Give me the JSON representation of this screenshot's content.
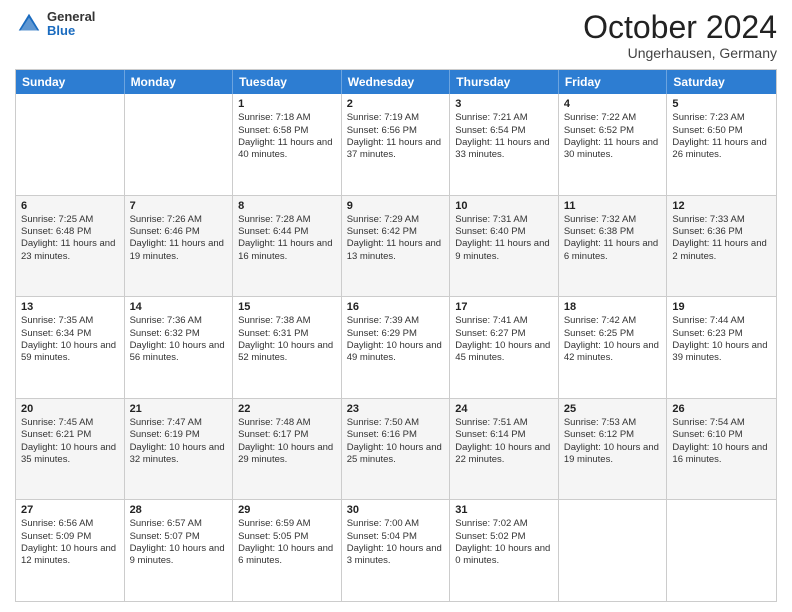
{
  "header": {
    "logo_general": "General",
    "logo_blue": "Blue",
    "month_title": "October 2024",
    "location": "Ungerhausen, Germany"
  },
  "days_of_week": [
    "Sunday",
    "Monday",
    "Tuesday",
    "Wednesday",
    "Thursday",
    "Friday",
    "Saturday"
  ],
  "rows": [
    [
      {
        "day": "",
        "sunrise": "",
        "sunset": "",
        "daylight": "",
        "shaded": false
      },
      {
        "day": "",
        "sunrise": "",
        "sunset": "",
        "daylight": "",
        "shaded": false
      },
      {
        "day": "1",
        "sunrise": "Sunrise: 7:18 AM",
        "sunset": "Sunset: 6:58 PM",
        "daylight": "Daylight: 11 hours and 40 minutes.",
        "shaded": false
      },
      {
        "day": "2",
        "sunrise": "Sunrise: 7:19 AM",
        "sunset": "Sunset: 6:56 PM",
        "daylight": "Daylight: 11 hours and 37 minutes.",
        "shaded": false
      },
      {
        "day": "3",
        "sunrise": "Sunrise: 7:21 AM",
        "sunset": "Sunset: 6:54 PM",
        "daylight": "Daylight: 11 hours and 33 minutes.",
        "shaded": false
      },
      {
        "day": "4",
        "sunrise": "Sunrise: 7:22 AM",
        "sunset": "Sunset: 6:52 PM",
        "daylight": "Daylight: 11 hours and 30 minutes.",
        "shaded": false
      },
      {
        "day": "5",
        "sunrise": "Sunrise: 7:23 AM",
        "sunset": "Sunset: 6:50 PM",
        "daylight": "Daylight: 11 hours and 26 minutes.",
        "shaded": false
      }
    ],
    [
      {
        "day": "6",
        "sunrise": "Sunrise: 7:25 AM",
        "sunset": "Sunset: 6:48 PM",
        "daylight": "Daylight: 11 hours and 23 minutes.",
        "shaded": true
      },
      {
        "day": "7",
        "sunrise": "Sunrise: 7:26 AM",
        "sunset": "Sunset: 6:46 PM",
        "daylight": "Daylight: 11 hours and 19 minutes.",
        "shaded": true
      },
      {
        "day": "8",
        "sunrise": "Sunrise: 7:28 AM",
        "sunset": "Sunset: 6:44 PM",
        "daylight": "Daylight: 11 hours and 16 minutes.",
        "shaded": true
      },
      {
        "day": "9",
        "sunrise": "Sunrise: 7:29 AM",
        "sunset": "Sunset: 6:42 PM",
        "daylight": "Daylight: 11 hours and 13 minutes.",
        "shaded": true
      },
      {
        "day": "10",
        "sunrise": "Sunrise: 7:31 AM",
        "sunset": "Sunset: 6:40 PM",
        "daylight": "Daylight: 11 hours and 9 minutes.",
        "shaded": true
      },
      {
        "day": "11",
        "sunrise": "Sunrise: 7:32 AM",
        "sunset": "Sunset: 6:38 PM",
        "daylight": "Daylight: 11 hours and 6 minutes.",
        "shaded": true
      },
      {
        "day": "12",
        "sunrise": "Sunrise: 7:33 AM",
        "sunset": "Sunset: 6:36 PM",
        "daylight": "Daylight: 11 hours and 2 minutes.",
        "shaded": true
      }
    ],
    [
      {
        "day": "13",
        "sunrise": "Sunrise: 7:35 AM",
        "sunset": "Sunset: 6:34 PM",
        "daylight": "Daylight: 10 hours and 59 minutes.",
        "shaded": false
      },
      {
        "day": "14",
        "sunrise": "Sunrise: 7:36 AM",
        "sunset": "Sunset: 6:32 PM",
        "daylight": "Daylight: 10 hours and 56 minutes.",
        "shaded": false
      },
      {
        "day": "15",
        "sunrise": "Sunrise: 7:38 AM",
        "sunset": "Sunset: 6:31 PM",
        "daylight": "Daylight: 10 hours and 52 minutes.",
        "shaded": false
      },
      {
        "day": "16",
        "sunrise": "Sunrise: 7:39 AM",
        "sunset": "Sunset: 6:29 PM",
        "daylight": "Daylight: 10 hours and 49 minutes.",
        "shaded": false
      },
      {
        "day": "17",
        "sunrise": "Sunrise: 7:41 AM",
        "sunset": "Sunset: 6:27 PM",
        "daylight": "Daylight: 10 hours and 45 minutes.",
        "shaded": false
      },
      {
        "day": "18",
        "sunrise": "Sunrise: 7:42 AM",
        "sunset": "Sunset: 6:25 PM",
        "daylight": "Daylight: 10 hours and 42 minutes.",
        "shaded": false
      },
      {
        "day": "19",
        "sunrise": "Sunrise: 7:44 AM",
        "sunset": "Sunset: 6:23 PM",
        "daylight": "Daylight: 10 hours and 39 minutes.",
        "shaded": false
      }
    ],
    [
      {
        "day": "20",
        "sunrise": "Sunrise: 7:45 AM",
        "sunset": "Sunset: 6:21 PM",
        "daylight": "Daylight: 10 hours and 35 minutes.",
        "shaded": true
      },
      {
        "day": "21",
        "sunrise": "Sunrise: 7:47 AM",
        "sunset": "Sunset: 6:19 PM",
        "daylight": "Daylight: 10 hours and 32 minutes.",
        "shaded": true
      },
      {
        "day": "22",
        "sunrise": "Sunrise: 7:48 AM",
        "sunset": "Sunset: 6:17 PM",
        "daylight": "Daylight: 10 hours and 29 minutes.",
        "shaded": true
      },
      {
        "day": "23",
        "sunrise": "Sunrise: 7:50 AM",
        "sunset": "Sunset: 6:16 PM",
        "daylight": "Daylight: 10 hours and 25 minutes.",
        "shaded": true
      },
      {
        "day": "24",
        "sunrise": "Sunrise: 7:51 AM",
        "sunset": "Sunset: 6:14 PM",
        "daylight": "Daylight: 10 hours and 22 minutes.",
        "shaded": true
      },
      {
        "day": "25",
        "sunrise": "Sunrise: 7:53 AM",
        "sunset": "Sunset: 6:12 PM",
        "daylight": "Daylight: 10 hours and 19 minutes.",
        "shaded": true
      },
      {
        "day": "26",
        "sunrise": "Sunrise: 7:54 AM",
        "sunset": "Sunset: 6:10 PM",
        "daylight": "Daylight: 10 hours and 16 minutes.",
        "shaded": true
      }
    ],
    [
      {
        "day": "27",
        "sunrise": "Sunrise: 6:56 AM",
        "sunset": "Sunset: 5:09 PM",
        "daylight": "Daylight: 10 hours and 12 minutes.",
        "shaded": false
      },
      {
        "day": "28",
        "sunrise": "Sunrise: 6:57 AM",
        "sunset": "Sunset: 5:07 PM",
        "daylight": "Daylight: 10 hours and 9 minutes.",
        "shaded": false
      },
      {
        "day": "29",
        "sunrise": "Sunrise: 6:59 AM",
        "sunset": "Sunset: 5:05 PM",
        "daylight": "Daylight: 10 hours and 6 minutes.",
        "shaded": false
      },
      {
        "day": "30",
        "sunrise": "Sunrise: 7:00 AM",
        "sunset": "Sunset: 5:04 PM",
        "daylight": "Daylight: 10 hours and 3 minutes.",
        "shaded": false
      },
      {
        "day": "31",
        "sunrise": "Sunrise: 7:02 AM",
        "sunset": "Sunset: 5:02 PM",
        "daylight": "Daylight: 10 hours and 0 minutes.",
        "shaded": false
      },
      {
        "day": "",
        "sunrise": "",
        "sunset": "",
        "daylight": "",
        "shaded": false
      },
      {
        "day": "",
        "sunrise": "",
        "sunset": "",
        "daylight": "",
        "shaded": false
      }
    ]
  ]
}
